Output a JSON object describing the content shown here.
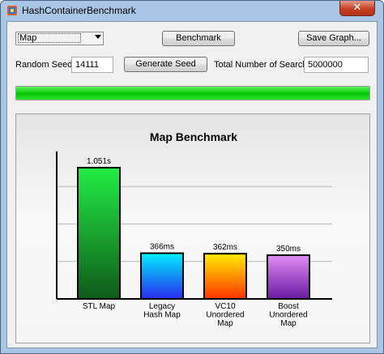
{
  "window": {
    "title": "HashContainerBenchmark",
    "close_label": "✕"
  },
  "toolbar": {
    "container_select": "Map",
    "benchmark_label": "Benchmark",
    "save_graph_label": "Save Graph...",
    "seed_label": "Random Seed:",
    "seed_value": "14111",
    "generate_seed_label": "Generate Seed",
    "search_count_label": "Total Number of Search:",
    "search_count_value": "5000000"
  },
  "progress": {
    "percent": 100,
    "color": "#10d010"
  },
  "chart_data": {
    "type": "bar",
    "title": "Map Benchmark",
    "categories": [
      "STL Map",
      "Legacy Hash Map",
      "VC10 Unordered Map",
      "Boost Unordered Map"
    ],
    "category_lines": [
      [
        "STL Map"
      ],
      [
        "Legacy",
        "Hash Map"
      ],
      [
        "VC10",
        "Unordered",
        "Map"
      ],
      [
        "Boost",
        "Unordered",
        "Map"
      ]
    ],
    "values": [
      1.051,
      0.366,
      0.362,
      0.35
    ],
    "value_labels": [
      "1.051s",
      "366ms",
      "362ms",
      "350ms"
    ],
    "ylim": [
      0,
      1.2
    ],
    "grid": true,
    "gradients": [
      [
        "#22ee44",
        "#0f5a1a"
      ],
      [
        "#00f0ff",
        "#2a2aee"
      ],
      [
        "#ffee00",
        "#ff3300"
      ],
      [
        "#e08cf6",
        "#6a1aa0"
      ]
    ]
  }
}
